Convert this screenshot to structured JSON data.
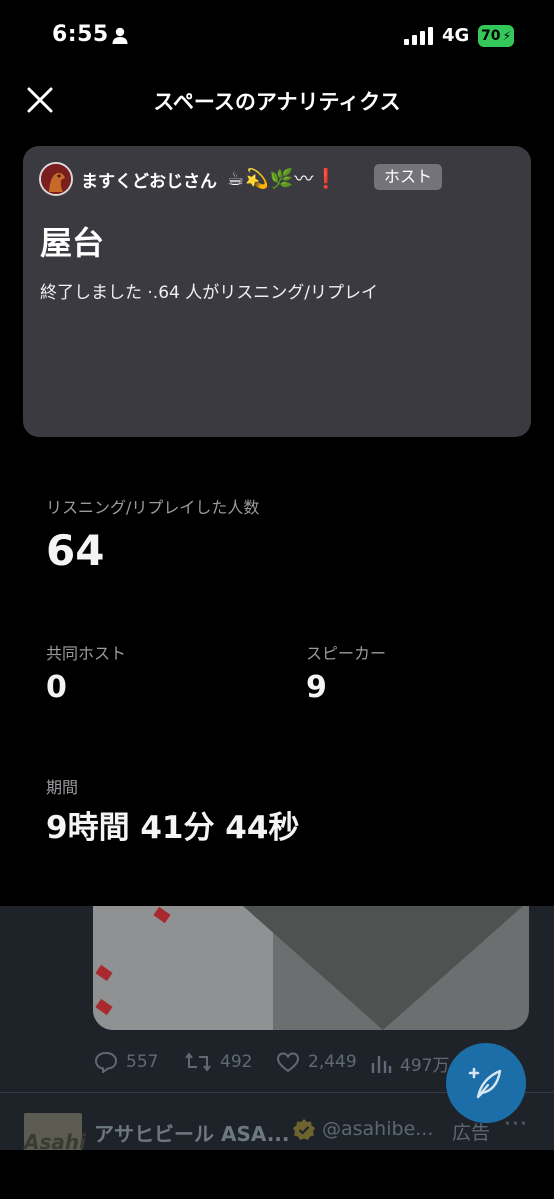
{
  "status_bar": {
    "time": "6:55",
    "network": "4G",
    "battery": "70"
  },
  "header": {
    "title": "スペースのアナリティクス"
  },
  "card": {
    "host_name": "ますくどおじさん",
    "host_emoji": "☕💫🌿〰",
    "host_emoji_end": "❗",
    "host_badge": "ホスト",
    "space_title": "屋台",
    "status_text": "終了しました ·.64 人がリスニング/リプレイ"
  },
  "stats": {
    "listeners_label": "リスニング/リプレイした人数",
    "listeners_value": "64",
    "cohost_label": "共同ホスト",
    "cohost_value": "0",
    "speakers_label": "スピーカー",
    "speakers_value": "9",
    "duration_label": "期間",
    "duration_value": "9時間 41分 44秒"
  },
  "feed": {
    "replies": "557",
    "retweets": "492",
    "likes": "2,449",
    "views": "497万",
    "ad": {
      "avatar_text": "Asahi",
      "name": "アサヒビール ASA...",
      "handle": "@asahibe...",
      "label": "広告",
      "more": "···"
    }
  }
}
